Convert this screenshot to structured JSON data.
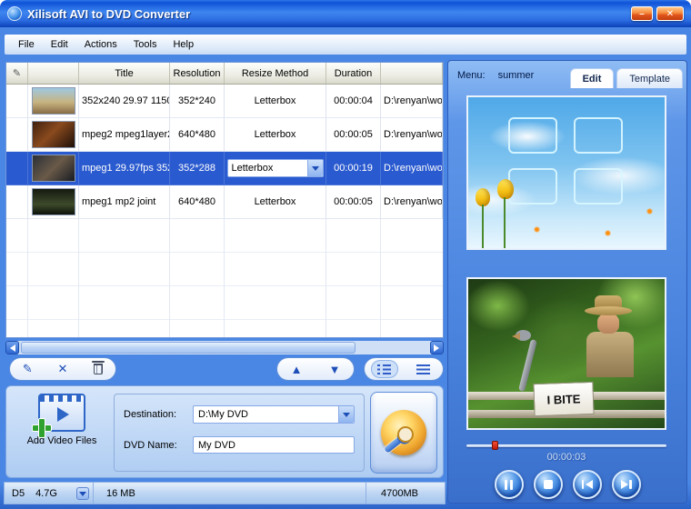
{
  "window": {
    "title": "Xilisoft AVI to DVD Converter"
  },
  "icons": {
    "minimize": "–",
    "close": "✕",
    "edit": "✎",
    "delete": "✕",
    "up": "▲",
    "down": "▼"
  },
  "menu": {
    "items": [
      "File",
      "Edit",
      "Actions",
      "Tools",
      "Help"
    ]
  },
  "file_table": {
    "headers": {
      "title": "Title",
      "resolution": "Resolution",
      "resize_method": "Resize Method",
      "duration": "Duration"
    },
    "rows": [
      {
        "title": "352x240 29.97 1150",
        "resolution": "352*240",
        "resize_method": "Letterbox",
        "duration": "00:00:04",
        "path": "D:\\renyan\\wor"
      },
      {
        "title": "mpeg2 mpeg1layer2",
        "resolution": "640*480",
        "resize_method": "Letterbox",
        "duration": "00:00:05",
        "path": "D:\\renyan\\wor"
      },
      {
        "title": "mpeg1 29.97fps 352",
        "resolution": "352*288",
        "resize_method": "Letterbox",
        "duration": "00:00:19",
        "path": "D:\\renyan\\wor"
      },
      {
        "title": "mpeg1 mp2 joint",
        "resolution": "640*480",
        "resize_method": "Letterbox",
        "duration": "00:00:05",
        "path": "D:\\renyan\\wor"
      }
    ]
  },
  "output": {
    "add_button_label": "Add Video Files",
    "destination_label": "Destination:",
    "destination_value": "D:\\My DVD",
    "dvd_name_label": "DVD Name:",
    "dvd_name_value": "My DVD"
  },
  "status_bar": {
    "disc_type": "D5",
    "disc_size": "4.7G",
    "used_size": "16 MB",
    "total_size": "4700MB"
  },
  "right_panel": {
    "menu_label": "Menu:",
    "menu_value": "summer",
    "tabs": [
      "Edit",
      "Template"
    ],
    "sign_text": "I BITE",
    "time": "00:00:03"
  }
}
